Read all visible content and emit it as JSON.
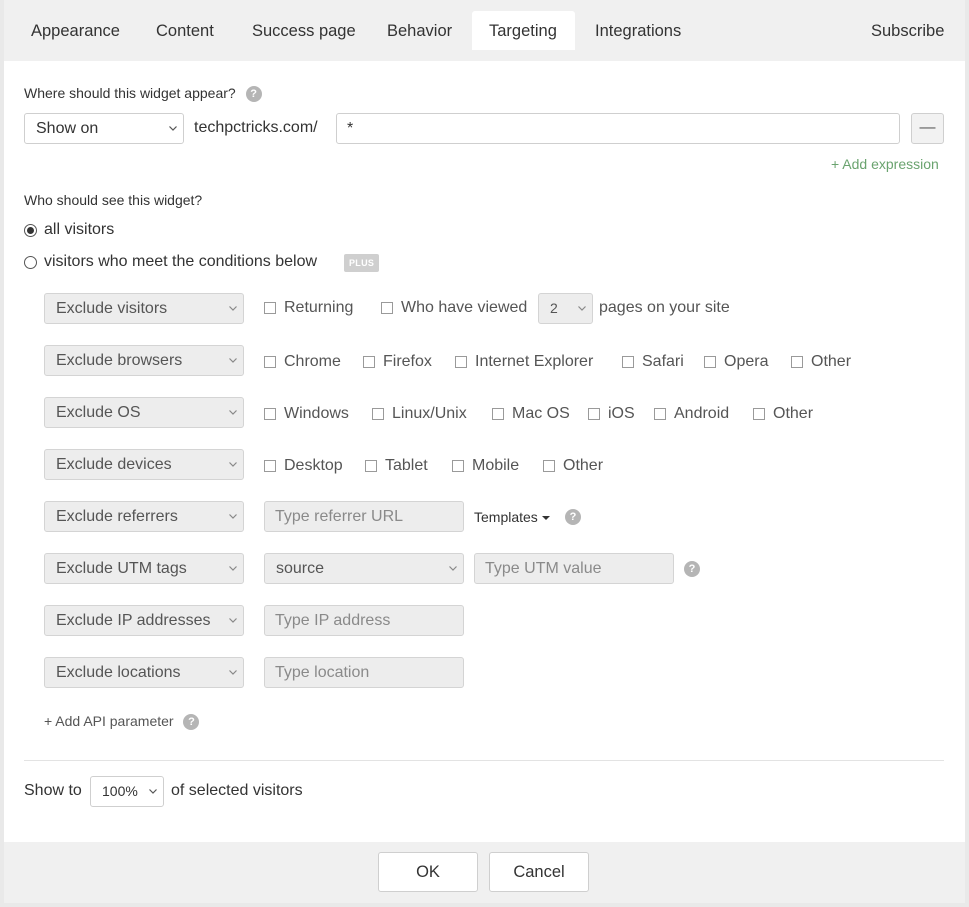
{
  "tabs": [
    {
      "label": "Appearance"
    },
    {
      "label": "Content"
    },
    {
      "label": "Success page"
    },
    {
      "label": "Behavior"
    },
    {
      "label": "Targeting"
    },
    {
      "label": "Integrations"
    }
  ],
  "subscribe_tab": "Subscribe",
  "where": {
    "question": "Where should this widget appear?",
    "show_select": "Show on",
    "domain": "techpctricks.com/",
    "expression": "*",
    "remove_label": "—",
    "add_expression": "+ Add expression"
  },
  "who": {
    "question": "Who should see this widget?",
    "all_visitors": "all visitors",
    "conditions": "visitors who meet the conditions below",
    "plus_badge": "PLUS"
  },
  "rules": {
    "visitors": {
      "select": "Exclude visitors",
      "returning": "Returning",
      "who_viewed": "Who have viewed",
      "pages_count": "2",
      "pages_suffix": "pages on your site"
    },
    "browsers": {
      "select": "Exclude browsers",
      "options": [
        "Chrome",
        "Firefox",
        "Internet Explorer",
        "Safari",
        "Opera",
        "Other"
      ]
    },
    "os": {
      "select": "Exclude OS",
      "options": [
        "Windows",
        "Linux/Unix",
        "Mac OS",
        "iOS",
        "Android",
        "Other"
      ]
    },
    "devices": {
      "select": "Exclude devices",
      "options": [
        "Desktop",
        "Tablet",
        "Mobile",
        "Other"
      ]
    },
    "referrers": {
      "select": "Exclude referrers",
      "placeholder": "Type referrer URL",
      "templates": "Templates"
    },
    "utm": {
      "select": "Exclude UTM tags",
      "tag_select": "source",
      "placeholder": "Type UTM value"
    },
    "ip": {
      "select": "Exclude IP addresses",
      "placeholder": "Type IP address"
    },
    "locations": {
      "select": "Exclude locations",
      "placeholder": "Type location"
    },
    "add_api": "+ Add API parameter"
  },
  "show_to": {
    "prefix": "Show to",
    "percent": "100%",
    "suffix": "of selected visitors"
  },
  "footer": {
    "ok": "OK",
    "cancel": "Cancel"
  },
  "help_glyph": "?",
  "icons": {
    "help": "question-circle-icon",
    "dropdown": "chevron-down-icon",
    "caret": "caret-down-icon"
  },
  "colors": {
    "accent_green": "#6aa36f",
    "tab_bar": "#f0f0f0",
    "disabled_field": "#ededed"
  }
}
